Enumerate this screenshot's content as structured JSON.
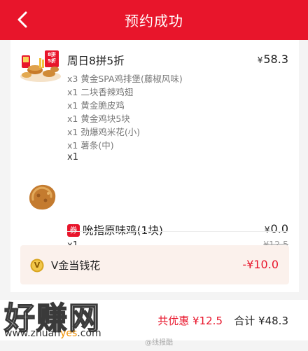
{
  "header": {
    "title": "预约成功"
  },
  "order": {
    "items": [
      {
        "name": "周日8拼5折",
        "price_symbol": "¥",
        "price": "58.3",
        "badge_line1": "8拼",
        "badge_line2": "5折",
        "contents": [
          "x3 黄金SPA鸡排堡(藤椒风味)",
          "x1 二块香辣鸡翅",
          "x1 黄金脆皮鸡",
          "x1 黄金鸡块5块",
          "x1 劲爆鸡米花(小)",
          "x1 薯条(中)"
        ],
        "quantity": "x1"
      },
      {
        "coupon_badge": "券",
        "name": "吮指原味鸡(1块)",
        "price_symbol": "¥",
        "price": "0.0",
        "original_price": "¥12.5",
        "quantity": "x1"
      }
    ]
  },
  "vgold": {
    "label": "V金当钱花",
    "amount": "-¥10.0",
    "icon_letter": "V"
  },
  "footer": {
    "discount": "共优惠 ¥12.5",
    "total": "合计 ¥48.3"
  },
  "watermark": {
    "main": "好赚网",
    "url_prefix": "www.zhuan",
    "url_highlight": "yes",
    "url_suffix": ".com",
    "weibo": "@线报酷"
  },
  "colors": {
    "brand_red": "#e8152b",
    "vgold_bg": "#fbf1ec",
    "gold": "#d9a520"
  }
}
